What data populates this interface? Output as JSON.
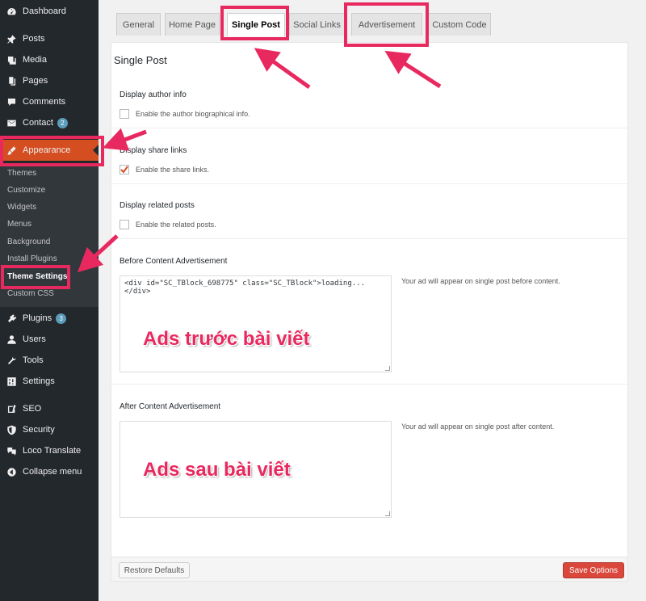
{
  "sidebar": {
    "items": [
      {
        "label": "Dashboard",
        "icon": "dashboard-icon"
      },
      {
        "label": "Posts",
        "icon": "pin-icon"
      },
      {
        "label": "Media",
        "icon": "media-icon"
      },
      {
        "label": "Pages",
        "icon": "pages-icon"
      },
      {
        "label": "Comments",
        "icon": "comment-icon"
      },
      {
        "label": "Contact",
        "icon": "mail-icon",
        "badge": "2"
      },
      {
        "label": "Appearance",
        "icon": "brush-icon"
      },
      {
        "label": "Plugins",
        "icon": "plugin-icon",
        "badge": "3"
      },
      {
        "label": "Users",
        "icon": "user-icon"
      },
      {
        "label": "Tools",
        "icon": "wrench-icon"
      },
      {
        "label": "Settings",
        "icon": "settings-icon"
      },
      {
        "label": "SEO",
        "icon": "seo-icon"
      },
      {
        "label": "Security",
        "icon": "shield-icon"
      },
      {
        "label": "Loco Translate",
        "icon": "translate-icon"
      },
      {
        "label": "Collapse menu",
        "icon": "collapse-icon"
      }
    ],
    "submenu": [
      "Themes",
      "Customize",
      "Widgets",
      "Menus",
      "Background",
      "Install Plugins",
      "Theme Settings",
      "Custom CSS"
    ]
  },
  "tabs": [
    "General",
    "Home Page",
    "Single Post",
    "Social Links",
    "Advertisement",
    "Custom Code"
  ],
  "panel": {
    "title": "Single Post",
    "author": {
      "label": "Display author info",
      "checkbox": "Enable the author biographical info.",
      "checked": false
    },
    "share": {
      "label": "Display share links",
      "checkbox": "Enable the share links.",
      "checked": true
    },
    "related": {
      "label": "Display related posts",
      "checkbox": "Enable the related posts.",
      "checked": false
    },
    "before_ad": {
      "label": "Before Content Advertisement",
      "value": "<div id=\"SC_TBlock_698775\" class=\"SC_TBlock\">loading...</div>",
      "help": "Your ad will appear on single post before content."
    },
    "after_ad": {
      "label": "After Content Advertisement",
      "value": "",
      "help": "Your ad will appear on single post after content."
    }
  },
  "overlay": {
    "before": "Ads trước bài viết",
    "after": "Ads sau bài viết"
  },
  "buttons": {
    "restore": "Restore Defaults",
    "save": "Save Options"
  },
  "colors": {
    "accent": "#e8295f",
    "sidebar": "#23282d",
    "appearance": "#d54e21",
    "save": "#d9483b"
  }
}
